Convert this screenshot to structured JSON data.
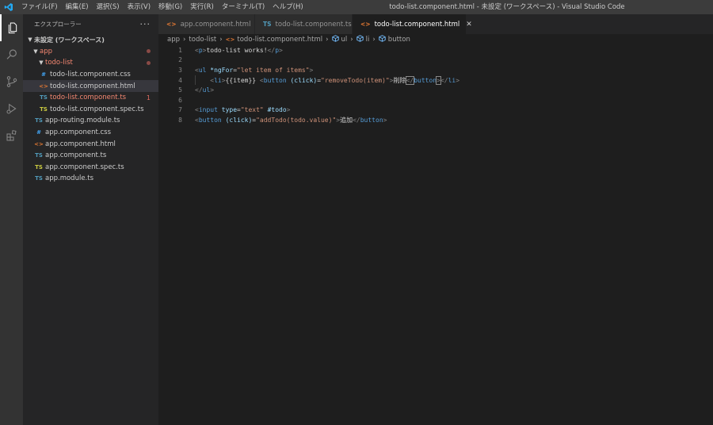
{
  "titlebar": {
    "window_title": "todo-list.component.html - 未設定 (ワークスペース) - Visual Studio Code",
    "menu": [
      "ファイル(F)",
      "編集(E)",
      "選択(S)",
      "表示(V)",
      "移動(G)",
      "実行(R)",
      "ターミナル(T)",
      "ヘルプ(H)"
    ]
  },
  "sidebar": {
    "title": "エクスプローラー",
    "more": "···",
    "workspace": "未設定 (ワークスペース)",
    "tree": [
      {
        "label": "app",
        "type": "folder",
        "icon_text": ""
      },
      {
        "label": "todo-list",
        "type": "folder",
        "icon_text": ""
      },
      {
        "label": "todo-list.component.css",
        "icon_text": "#"
      },
      {
        "label": "todo-list.component.html",
        "icon_text": "<>"
      },
      {
        "label": "todo-list.component.ts",
        "icon_text": "TS",
        "badge": "1"
      },
      {
        "label": "todo-list.component.spec.ts",
        "icon_text": "TS"
      },
      {
        "label": "app-routing.module.ts",
        "icon_text": "TS"
      },
      {
        "label": "app.component.css",
        "icon_text": "#"
      },
      {
        "label": "app.component.html",
        "icon_text": "<>"
      },
      {
        "label": "app.component.ts",
        "icon_text": "TS"
      },
      {
        "label": "app.component.spec.ts",
        "icon_text": "TS"
      },
      {
        "label": "app.module.ts",
        "icon_text": "TS"
      }
    ]
  },
  "tabs": [
    {
      "label": "app.component.html",
      "icon_text": "<>"
    },
    {
      "label": "todo-list.component.ts",
      "icon_text": "TS"
    },
    {
      "label": "todo-list.component.html",
      "icon_text": "<>",
      "close": "✕"
    }
  ],
  "breadcrumb": [
    "app",
    "todo-list",
    "todo-list.component.html",
    "ul",
    "li",
    "button"
  ],
  "editor": {
    "line_numbers": [
      "1",
      "2",
      "3",
      "4",
      "5",
      "6",
      "7",
      "8"
    ],
    "line1": {
      "open": "<",
      "tag": "p",
      "close": ">",
      "text": "todo-list works!",
      "end_open": "</",
      "end_tag": "p",
      "end_close": ">"
    },
    "line3": {
      "open": "<",
      "tag": "ul",
      "sp": " ",
      "attr": "*ngFor",
      "eq": "=",
      "val": "\"let item of items\"",
      "close": ">"
    },
    "line4": {
      "indent": "    ",
      "open": "<",
      "tag": "li",
      "close": ">",
      "interp": "{{item}}",
      "sp": " ",
      "open2": "<",
      "tag2": "button",
      "sp2": " ",
      "attr": "(click)",
      "eq": "=",
      "val": "\"removeTodo(item)\"",
      "close2": ">",
      "text": "削除",
      "end_open": "</",
      "end_tag": "button",
      "end_close": ">",
      "end_open2": "</",
      "end_tag2": "li",
      "end_close2": ">"
    },
    "line5": {
      "open": "</",
      "tag": "ul",
      "close": ">"
    },
    "line7": {
      "open": "<",
      "tag": "input",
      "sp": " ",
      "attr": "type",
      "eq": "=",
      "val": "\"text\"",
      "sp2": " ",
      "attr2": "#todo",
      "close": ">"
    },
    "line8": {
      "open": "<",
      "tag": "button",
      "sp": " ",
      "attr": "(click)",
      "eq": "=",
      "val": "\"addTodo(todo.value)\"",
      "close": ">",
      "text": "追加",
      "end_open": "</",
      "end_tag": "button",
      "end_close": ">"
    }
  },
  "colors": {
    "accent": "#007acc",
    "error": "#f48771",
    "html_icon": "#e37933",
    "ts_icon": "#519aba",
    "css_icon": "#42a5f5",
    "spec_icon": "#cbcb41"
  }
}
